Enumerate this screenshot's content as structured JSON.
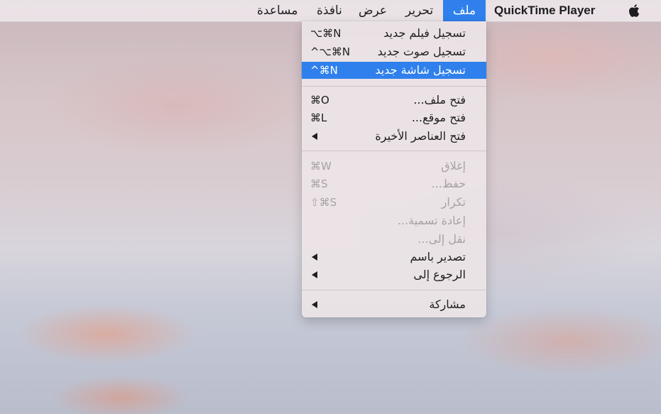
{
  "menubar": {
    "app_name": "QuickTime Player",
    "items": [
      "ملف",
      "تحرير",
      "عرض",
      "نافذة",
      "مساعدة"
    ],
    "active_item": "ملف"
  },
  "file_menu": {
    "group1": [
      {
        "label": "تسجيل فيلم جديد",
        "shortcut": "⌥⌘N"
      },
      {
        "label": "تسجيل صوت جديد",
        "shortcut": "^⌥⌘N"
      },
      {
        "label": "تسجيل شاشة جديد",
        "shortcut": "^⌘N",
        "highlighted": true
      }
    ],
    "group2": [
      {
        "label": "فتح ملف...",
        "shortcut": "⌘O"
      },
      {
        "label": "فتح موقع...",
        "shortcut": "⌘L"
      },
      {
        "label": "فتح العناصر الأخيرة",
        "submenu": true
      }
    ],
    "group3": [
      {
        "label": "إغلاق",
        "shortcut": "⌘W",
        "disabled": true
      },
      {
        "label": "حفظ...",
        "shortcut": "⌘S",
        "disabled": true
      },
      {
        "label": "تكرار",
        "shortcut": "⇧⌘S",
        "disabled": true
      },
      {
        "label": "إعادة تسمية...",
        "disabled": true
      },
      {
        "label": "نقل إلى...",
        "disabled": true
      },
      {
        "label": "تصدير باسم",
        "submenu": true
      },
      {
        "label": "الرجوع إلى",
        "submenu": true
      }
    ],
    "group4": [
      {
        "label": "مشاركة",
        "submenu": true
      }
    ]
  },
  "colors": {
    "highlight": "#2f80ed",
    "disabled_text": "#a8a1a4"
  },
  "icons": {
    "apple": "apple-logo-icon",
    "submenu": "submenu-arrow-icon"
  }
}
